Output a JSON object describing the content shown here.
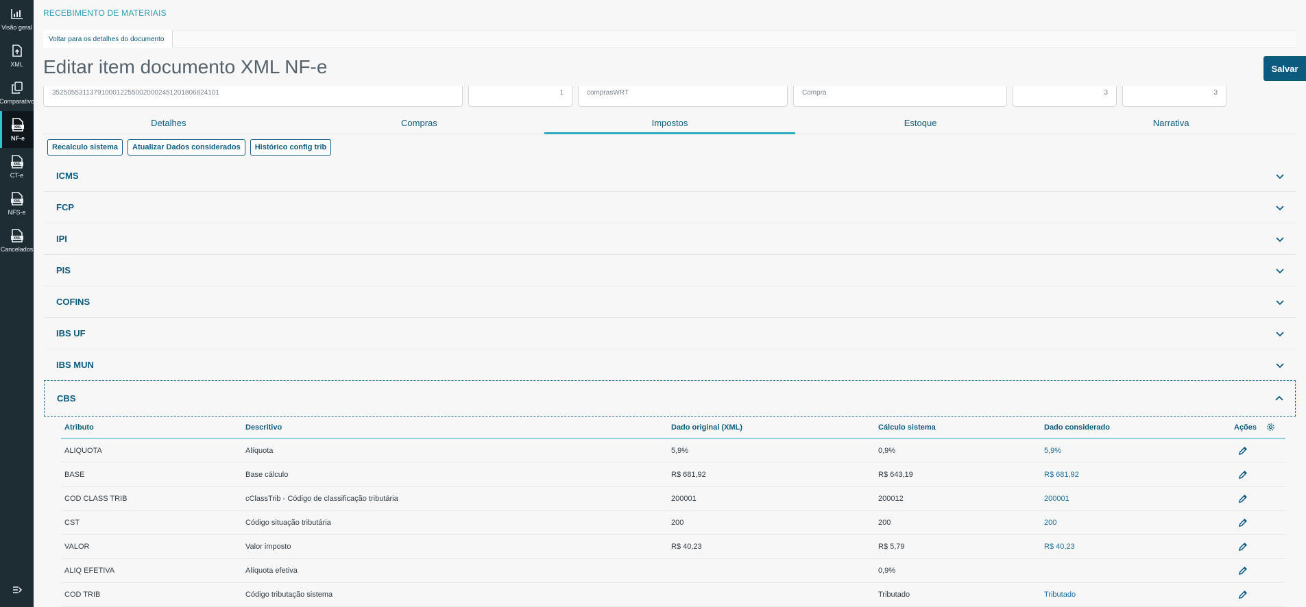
{
  "sidebar": {
    "items": [
      {
        "label": "Visão geral",
        "icon": "bar-chart-icon"
      },
      {
        "label": "XML",
        "icon": "file-upload-icon"
      },
      {
        "label": "Comparativo",
        "icon": "copy-icon"
      },
      {
        "label": "NF-e",
        "icon": "xml-file-icon",
        "active": true
      },
      {
        "label": "CT-e",
        "icon": "xml-file-icon"
      },
      {
        "label": "NFS-e",
        "icon": "xml-file-icon"
      },
      {
        "label": "Cancelados",
        "icon": "xml-file-icon"
      }
    ]
  },
  "header": {
    "app_title": "RECEBIMENTO DE MATERIAIS",
    "breadcrumb": "Voltar para os detalhes do documento",
    "page_title": "Editar item documento XML NF-e",
    "save_label": "Salvar"
  },
  "fields": [
    "35250553113791000122550020002451201806824101",
    "1",
    "comprasWRT",
    "Compra",
    "3",
    "3"
  ],
  "tabs": [
    "Detalhes",
    "Compras",
    "Impostos",
    "Estoque",
    "Narrativa"
  ],
  "active_tab": "Impostos",
  "action_buttons": [
    "Recalculo sistema",
    "Atualizar Dados considerados",
    "Histórico config trib"
  ],
  "accordion": [
    "ICMS",
    "FCP",
    "IPI",
    "PIS",
    "COFINS",
    "IBS UF",
    "IBS MUN",
    "CBS"
  ],
  "open_section": "CBS",
  "table": {
    "headers": [
      "Atributo",
      "Descritivo",
      "Dado original (XML)",
      "Cálculo sistema",
      "Dado considerado",
      "Ações"
    ],
    "rows": [
      [
        "ALIQUOTA",
        "Alíquota",
        "5,9%",
        "0,9%",
        "5,9%"
      ],
      [
        "BASE",
        "Base cálculo",
        "R$ 681,92",
        "R$ 643,19",
        "R$ 681,92"
      ],
      [
        "COD CLASS TRIB",
        "cClassTrib - Código de classificação tributária",
        "200001",
        "200012",
        "200001"
      ],
      [
        "CST",
        "Código situação tributária",
        "200",
        "200",
        "200"
      ],
      [
        "VALOR",
        "Valor imposto",
        "R$ 40,23",
        "R$ 5,79",
        "R$ 40,23"
      ],
      [
        "ALIQ EFETIVA",
        "Alíquota efetiva",
        "",
        "0,9%",
        ""
      ],
      [
        "COD TRIB",
        "Código tributação sistema",
        "",
        "Tributado",
        "Tributado"
      ]
    ]
  },
  "colors": {
    "primary": "#0c5b7f",
    "accent": "#2fa8c2",
    "sidebar": "#1e2c33"
  }
}
